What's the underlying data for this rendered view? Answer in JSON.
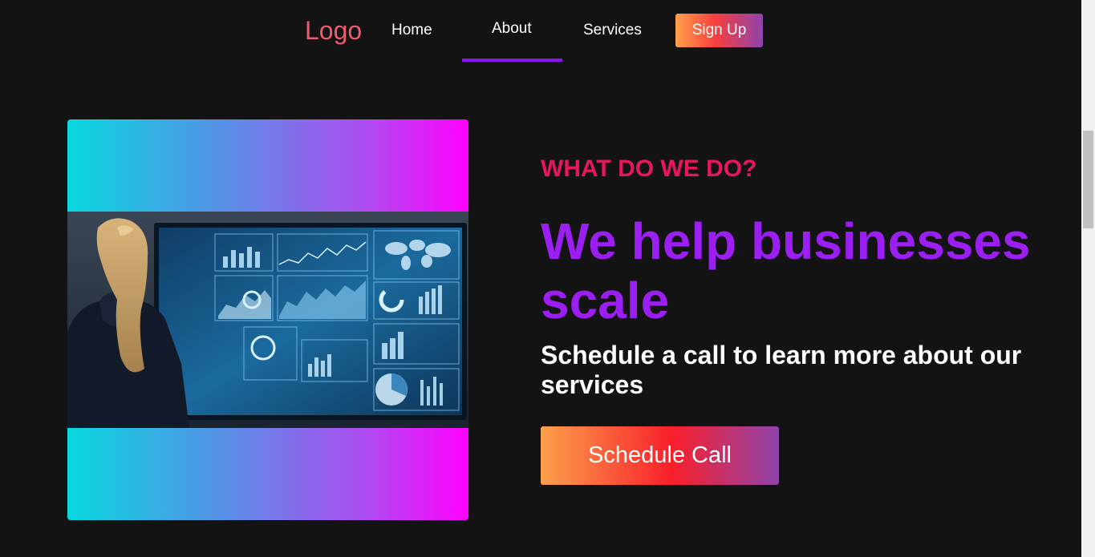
{
  "nav": {
    "logo": "Logo",
    "links": [
      {
        "label": "Home"
      },
      {
        "label": "About",
        "active": true
      },
      {
        "label": "Services"
      }
    ],
    "signup_label": "Sign Up"
  },
  "hero": {
    "eyebrow": "WHAT DO WE DO?",
    "headline": "We help businesses scale",
    "subhead": "Schedule a call to learn more about our services",
    "cta_label": "Schedule Call",
    "image_subject": "woman-viewing-analytics-dashboard-screen"
  },
  "colors": {
    "background": "#131313",
    "logo": "#ef5a6f",
    "accent_purple": "#9b1ff2",
    "eyebrow_pink": "#e8175d",
    "gradient_cyan": "#08d8e0",
    "gradient_magenta": "#ff00ff",
    "button_orange": "#fca14c",
    "button_red": "#f91f2a",
    "button_purple": "#8e44ad"
  }
}
